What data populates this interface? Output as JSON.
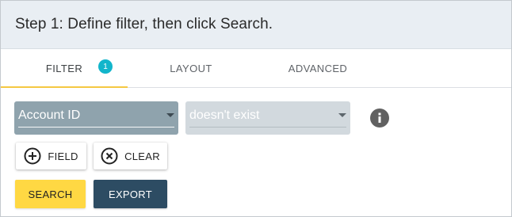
{
  "header": {
    "title": "Step 1: Define filter, then click Search."
  },
  "tabs": [
    {
      "label": "FILTER",
      "badge": "1",
      "active": true
    },
    {
      "label": "LAYOUT",
      "active": false
    },
    {
      "label": "ADVANCED",
      "active": false
    }
  ],
  "filter": {
    "field_value": "Account ID",
    "operator_value": "doesn't exist",
    "info_icon": "info-icon"
  },
  "buttons": {
    "add_field": {
      "label": "FIELD",
      "icon": "plus-circle-icon"
    },
    "clear": {
      "label": "CLEAR",
      "icon": "x-circle-icon"
    },
    "search": {
      "label": "SEARCH"
    },
    "export": {
      "label": "EXPORT"
    }
  },
  "colors": {
    "header_bg": "#e9eef3",
    "tab_active_underline": "#f5c842",
    "badge": "#12b5cb",
    "field_select_bg": "#8fa3ad",
    "operator_select_bg": "#d2d9de",
    "search_button": "#ffd843",
    "export_button": "#2d4c63"
  }
}
